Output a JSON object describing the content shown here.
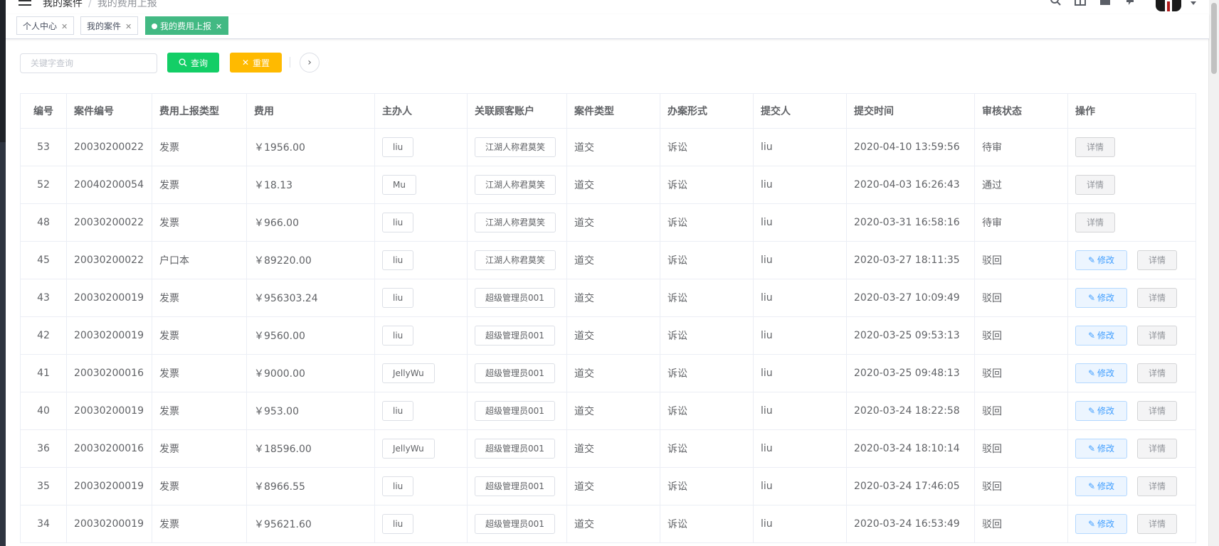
{
  "header": {
    "breadcrumb": [
      "我的案件",
      "我的费用上报"
    ],
    "tool_icons": [
      "search-icon",
      "fullscreen-icon",
      "size-icon",
      "bell-icon"
    ],
    "avatar": "avatar"
  },
  "tags": [
    {
      "label": "个人中心",
      "active": false
    },
    {
      "label": "我的案件",
      "active": false
    },
    {
      "label": "我的费用上报",
      "active": true
    }
  ],
  "filters": {
    "search_placeholder": "关键字查询",
    "search_label": "查询",
    "reset_label": "重置"
  },
  "table": {
    "columns": [
      "编号",
      "案件编号",
      "费用上报类型",
      "费用",
      "主办人",
      "关联顾客账户",
      "案件类型",
      "办案形式",
      "提交人",
      "提交时间",
      "审核状态",
      "操作"
    ],
    "edit_label": "修改",
    "detail_label": "详情",
    "rows": [
      {
        "id": "53",
        "case_no": "20030200022",
        "type": "发票",
        "fee": "￥1956.00",
        "host": "liu",
        "customer": "江湖人称君莫笑",
        "case_type": "道交",
        "mode": "诉讼",
        "submitter": "liu",
        "time": "2020-04-10 13:59:56",
        "status": "待审",
        "editable": false
      },
      {
        "id": "52",
        "case_no": "20040200054",
        "type": "发票",
        "fee": "￥18.13",
        "host": "Mu",
        "customer": "江湖人称君莫笑",
        "case_type": "道交",
        "mode": "诉讼",
        "submitter": "liu",
        "time": "2020-04-03 16:26:43",
        "status": "通过",
        "editable": false
      },
      {
        "id": "48",
        "case_no": "20030200022",
        "type": "发票",
        "fee": "￥966.00",
        "host": "liu",
        "customer": "江湖人称君莫笑",
        "case_type": "道交",
        "mode": "诉讼",
        "submitter": "liu",
        "time": "2020-03-31 16:58:16",
        "status": "待审",
        "editable": false
      },
      {
        "id": "45",
        "case_no": "20030200022",
        "type": "户口本",
        "fee": "￥89220.00",
        "host": "liu",
        "customer": "江湖人称君莫笑",
        "case_type": "道交",
        "mode": "诉讼",
        "submitter": "liu",
        "time": "2020-03-27 18:11:35",
        "status": "驳回",
        "editable": true
      },
      {
        "id": "43",
        "case_no": "20030200019",
        "type": "发票",
        "fee": "￥956303.24",
        "host": "liu",
        "customer": "超级管理员001",
        "case_type": "道交",
        "mode": "诉讼",
        "submitter": "liu",
        "time": "2020-03-27 10:09:49",
        "status": "驳回",
        "editable": true
      },
      {
        "id": "42",
        "case_no": "20030200019",
        "type": "发票",
        "fee": "￥9560.00",
        "host": "liu",
        "customer": "超级管理员001",
        "case_type": "道交",
        "mode": "诉讼",
        "submitter": "liu",
        "time": "2020-03-25 09:53:13",
        "status": "驳回",
        "editable": true
      },
      {
        "id": "41",
        "case_no": "20030200016",
        "type": "发票",
        "fee": "￥9000.00",
        "host": "JellyWu",
        "customer": "超级管理员001",
        "case_type": "道交",
        "mode": "诉讼",
        "submitter": "liu",
        "time": "2020-03-25 09:48:13",
        "status": "驳回",
        "editable": true
      },
      {
        "id": "40",
        "case_no": "20030200019",
        "type": "发票",
        "fee": "￥953.00",
        "host": "liu",
        "customer": "超级管理员001",
        "case_type": "道交",
        "mode": "诉讼",
        "submitter": "liu",
        "time": "2020-03-24 18:22:58",
        "status": "驳回",
        "editable": true
      },
      {
        "id": "36",
        "case_no": "20030200016",
        "type": "发票",
        "fee": "￥18596.00",
        "host": "JellyWu",
        "customer": "超级管理员001",
        "case_type": "道交",
        "mode": "诉讼",
        "submitter": "liu",
        "time": "2020-03-24 18:10:14",
        "status": "驳回",
        "editable": true
      },
      {
        "id": "35",
        "case_no": "20030200019",
        "type": "发票",
        "fee": "￥8966.55",
        "host": "liu",
        "customer": "超级管理员001",
        "case_type": "道交",
        "mode": "诉讼",
        "submitter": "liu",
        "time": "2020-03-24 17:46:05",
        "status": "驳回",
        "editable": true
      },
      {
        "id": "34",
        "case_no": "20030200019",
        "type": "发票",
        "fee": "￥95621.60",
        "host": "liu",
        "customer": "超级管理员001",
        "case_type": "道交",
        "mode": "诉讼",
        "submitter": "liu",
        "time": "2020-03-24 16:53:49",
        "status": "驳回",
        "editable": true
      }
    ]
  }
}
